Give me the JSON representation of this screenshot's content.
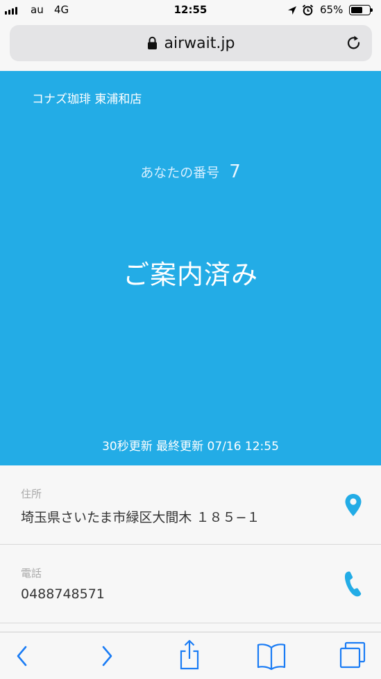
{
  "status_bar": {
    "carrier": "au",
    "network": "4G",
    "time": "12:55",
    "battery_percent": "65%",
    "battery_level": 0.65,
    "icons": [
      "signal-icon",
      "location-arrow-icon",
      "alarm-icon",
      "battery-icon"
    ]
  },
  "browser": {
    "url": "airwait.jp",
    "icons": [
      "lock-icon",
      "reload-icon"
    ]
  },
  "hero": {
    "shop_name": "コナズ珈琲 東浦和店",
    "number_label": "あなたの番号",
    "number": "7",
    "status": "ご案内済み",
    "update_info": "30秒更新 最終更新 07/16 12:55"
  },
  "info": {
    "address_label": "住所",
    "address": "埼玉県さいたま市緑区大間木 １８５−１",
    "phone_label": "電話",
    "phone": "0488748571"
  },
  "toolbar": {
    "icons": [
      "back-icon",
      "forward-icon",
      "share-icon",
      "bookmarks-icon",
      "tabs-icon"
    ]
  },
  "colors": {
    "accent": "#23ace6",
    "ios_blue": "#1a7cf5",
    "background": "#f7f7f7"
  }
}
